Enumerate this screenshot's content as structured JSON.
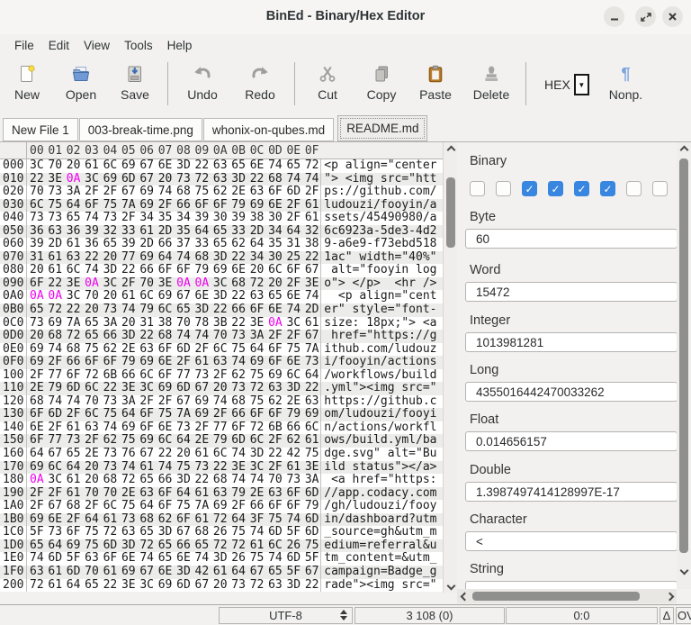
{
  "window": {
    "title": "BinEd - Binary/Hex Editor",
    "controls": [
      "minimize",
      "restore",
      "close"
    ]
  },
  "menu": {
    "items": [
      "File",
      "Edit",
      "View",
      "Tools",
      "Help"
    ]
  },
  "toolbar": {
    "new": "New",
    "open": "Open",
    "save": "Save",
    "undo": "Undo",
    "redo": "Redo",
    "cut": "Cut",
    "copy": "Copy",
    "paste": "Paste",
    "delete": "Delete",
    "code_type": "HEX",
    "nonprintables": "Nonp."
  },
  "tabs": {
    "items": [
      {
        "label": "New File 1"
      },
      {
        "label": "003-break-time.png"
      },
      {
        "label": "whonix-on-qubes.md"
      },
      {
        "label": "README.md"
      }
    ],
    "active": "README.md"
  },
  "hex": {
    "columns": [
      "00",
      "01",
      "02",
      "03",
      "04",
      "05",
      "06",
      "07",
      "08",
      "09",
      "0A",
      "0B",
      "0C",
      "0D",
      "0E",
      "0F"
    ],
    "nonprintable_byte": "0A",
    "rows": [
      {
        "addr": "000",
        "bytes": "3C 70 20 61 6C 69 67 6E 3D 22 63 65 6E 74 65 72",
        "preview": "<p align=\"center"
      },
      {
        "addr": "010",
        "bytes": "22 3E 0A 3C 69 6D 67 20 73 72 63 3D 22 68 74 74",
        "preview": "\"> <img src=\"htt"
      },
      {
        "addr": "020",
        "bytes": "70 73 3A 2F 2F 67 69 74 68 75 62 2E 63 6F 6D 2F",
        "preview": "ps://github.com/"
      },
      {
        "addr": "030",
        "bytes": "6C 75 64 6F 75 7A 69 2F 66 6F 6F 79 69 6E 2F 61",
        "preview": "ludouzi/fooyin/a"
      },
      {
        "addr": "040",
        "bytes": "73 73 65 74 73 2F 34 35 34 39 30 39 38 30 2F 61",
        "preview": "ssets/45490980/a"
      },
      {
        "addr": "050",
        "bytes": "36 63 36 39 32 33 61 2D 35 64 65 33 2D 34 64 32",
        "preview": "6c6923a-5de3-4d2"
      },
      {
        "addr": "060",
        "bytes": "39 2D 61 36 65 39 2D 66 37 33 65 62 64 35 31 38",
        "preview": "9-a6e9-f73ebd518"
      },
      {
        "addr": "070",
        "bytes": "31 61 63 22 20 77 69 64 74 68 3D 22 34 30 25 22",
        "preview": "1ac\" width=\"40%\""
      },
      {
        "addr": "080",
        "bytes": "20 61 6C 74 3D 22 66 6F 6F 79 69 6E 20 6C 6F 67",
        "preview": " alt=\"fooyin log"
      },
      {
        "addr": "090",
        "bytes": "6F 22 3E 0A 3C 2F 70 3E 0A 0A 3C 68 72 20 2F 3E",
        "preview": "o\"> </p>  <hr />"
      },
      {
        "addr": "0A0",
        "bytes": "0A 0A 3C 70 20 61 6C 69 67 6E 3D 22 63 65 6E 74",
        "preview": "  <p align=\"cent"
      },
      {
        "addr": "0B0",
        "bytes": "65 72 22 20 73 74 79 6C 65 3D 22 66 6F 6E 74 2D",
        "preview": "er\" style=\"font-"
      },
      {
        "addr": "0C0",
        "bytes": "73 69 7A 65 3A 20 31 38 70 78 3B 22 3E 0A 3C 61",
        "preview": "size: 18px;\"> <a"
      },
      {
        "addr": "0D0",
        "bytes": "20 68 72 65 66 3D 22 68 74 74 70 73 3A 2F 2F 67",
        "preview": " href=\"https://g"
      },
      {
        "addr": "0E0",
        "bytes": "69 74 68 75 62 2E 63 6F 6D 2F 6C 75 64 6F 75 7A",
        "preview": "ithub.com/ludouz"
      },
      {
        "addr": "0F0",
        "bytes": "69 2F 66 6F 6F 79 69 6E 2F 61 63 74 69 6F 6E 73",
        "preview": "i/fooyin/actions"
      },
      {
        "addr": "100",
        "bytes": "2F 77 6F 72 6B 66 6C 6F 77 73 2F 62 75 69 6C 64",
        "preview": "/workflows/build"
      },
      {
        "addr": "110",
        "bytes": "2E 79 6D 6C 22 3E 3C 69 6D 67 20 73 72 63 3D 22",
        "preview": ".yml\"><img src=\""
      },
      {
        "addr": "120",
        "bytes": "68 74 74 70 73 3A 2F 2F 67 69 74 68 75 62 2E 63",
        "preview": "https://github.c"
      },
      {
        "addr": "130",
        "bytes": "6F 6D 2F 6C 75 64 6F 75 7A 69 2F 66 6F 6F 79 69",
        "preview": "om/ludouzi/fooyi"
      },
      {
        "addr": "140",
        "bytes": "6E 2F 61 63 74 69 6F 6E 73 2F 77 6F 72 6B 66 6C",
        "preview": "n/actions/workfl"
      },
      {
        "addr": "150",
        "bytes": "6F 77 73 2F 62 75 69 6C 64 2E 79 6D 6C 2F 62 61",
        "preview": "ows/build.yml/ba"
      },
      {
        "addr": "160",
        "bytes": "64 67 65 2E 73 76 67 22 20 61 6C 74 3D 22 42 75",
        "preview": "dge.svg\" alt=\"Bu"
      },
      {
        "addr": "170",
        "bytes": "69 6C 64 20 73 74 61 74 75 73 22 3E 3C 2F 61 3E",
        "preview": "ild status\"></a>"
      },
      {
        "addr": "180",
        "bytes": "0A 3C 61 20 68 72 65 66 3D 22 68 74 74 70 73 3A",
        "preview": " <a href=\"https:"
      },
      {
        "addr": "190",
        "bytes": "2F 2F 61 70 70 2E 63 6F 64 61 63 79 2E 63 6F 6D",
        "preview": "//app.codacy.com"
      },
      {
        "addr": "1A0",
        "bytes": "2F 67 68 2F 6C 75 64 6F 75 7A 69 2F 66 6F 6F 79",
        "preview": "/gh/ludouzi/fooy"
      },
      {
        "addr": "1B0",
        "bytes": "69 6E 2F 64 61 73 68 62 6F 61 72 64 3F 75 74 6D",
        "preview": "in/dashboard?utm"
      },
      {
        "addr": "1C0",
        "bytes": "5F 73 6F 75 72 63 65 3D 67 68 26 75 74 6D 5F 6D",
        "preview": "_source=gh&utm_m"
      },
      {
        "addr": "1D0",
        "bytes": "65 64 69 75 6D 3D 72 65 66 65 72 72 61 6C 26 75",
        "preview": "edium=referral&u"
      },
      {
        "addr": "1E0",
        "bytes": "74 6D 5F 63 6F 6E 74 65 6E 74 3D 26 75 74 6D 5F",
        "preview": "tm_content=&utm_"
      },
      {
        "addr": "1F0",
        "bytes": "63 61 6D 70 61 69 67 6E 3D 42 61 64 67 65 5F 67",
        "preview": "campaign=Badge_g"
      },
      {
        "addr": "200",
        "bytes": "72 61 64 65 22 3E 3C 69 6D 67 20 73 72 63 3D 22",
        "preview": "rade\"><img src=\""
      }
    ]
  },
  "inspector": {
    "binary_label": "Binary",
    "binary_bits": [
      0,
      0,
      1,
      1,
      1,
      1,
      0,
      0
    ],
    "fields": [
      {
        "label": "Byte",
        "value": "60"
      },
      {
        "label": "Word",
        "value": "15472"
      },
      {
        "label": "Integer",
        "value": "1013981281"
      },
      {
        "label": "Long",
        "value": "4355016442470033262"
      },
      {
        "label": "Float",
        "value": "0.014656157"
      },
      {
        "label": "Double",
        "value": "1.3987497414128997E-17"
      },
      {
        "label": "Character",
        "value": "<"
      },
      {
        "label": "String",
        "value": ""
      }
    ]
  },
  "status": {
    "encoding": "UTF-8",
    "document_size": "3 108 (0)",
    "cursor_position": "0:0",
    "modified_indicator": "Δ",
    "edit_mode": "OVR"
  },
  "colors": {
    "nonprintable": "#ee00ee",
    "checkbox_checked": "#3986e0",
    "icon_blue": "#6f9ad6",
    "icon_yellow": "#f6dd4a",
    "clipboard_brown": "#c08033",
    "icon_gray": "#a09e9a"
  }
}
